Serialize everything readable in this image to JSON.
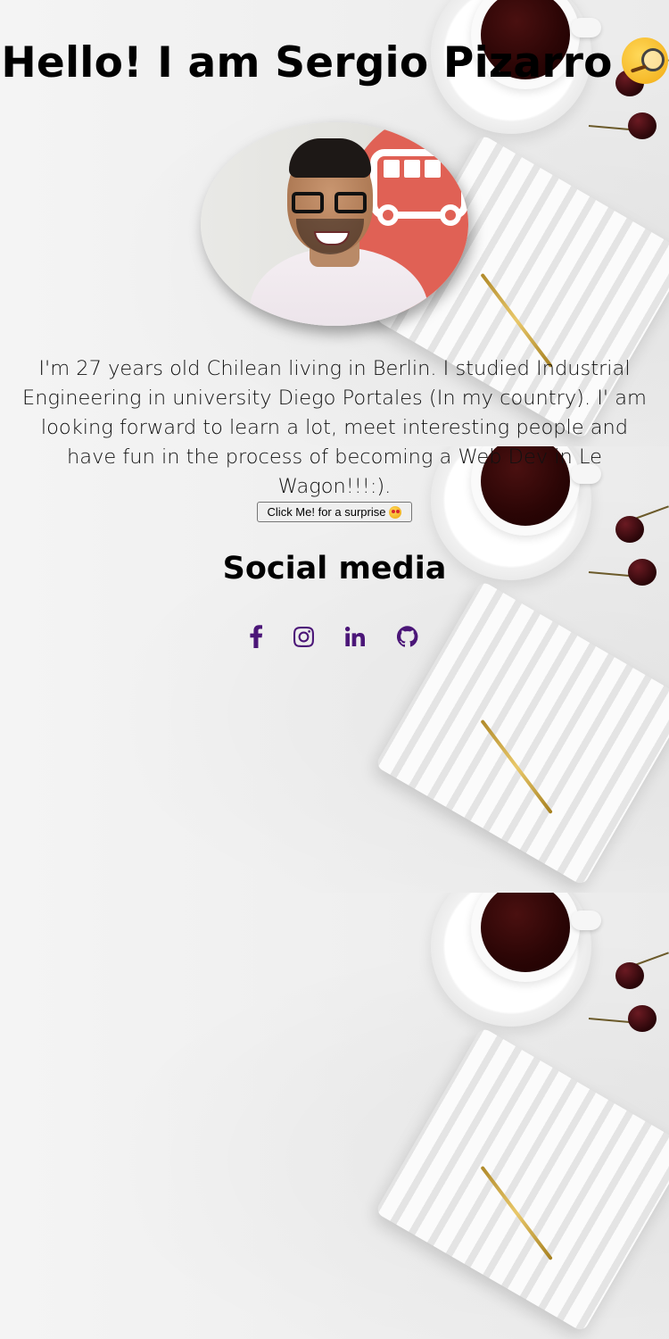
{
  "header": {
    "title": "Hello! I am Sergio Pizarro",
    "title_emoji": "face-with-monocle-icon"
  },
  "profile": {
    "avatar": "profile-photo"
  },
  "bio": {
    "text": "I'm 27 years old Chilean living in Berlin. I studied Industrial Engineering in university Diego Portales (In my country). I' am looking forward to learn a lot, meet interesting people and have fun in the process of becoming a Web Dev in Le Wagon!!!:)."
  },
  "surprise_button": {
    "label": "Click Me! for a surprise",
    "emoji": "star-struck-icon"
  },
  "social": {
    "title": "Social media",
    "links": [
      {
        "icon": "facebook-icon"
      },
      {
        "icon": "instagram-icon"
      },
      {
        "icon": "linkedin-icon"
      },
      {
        "icon": "github-icon"
      }
    ],
    "icon_color": "#4b1678"
  }
}
